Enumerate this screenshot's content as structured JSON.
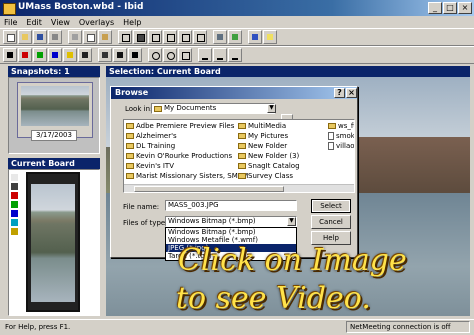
{
  "window": {
    "title": "UMass Boston.wbd - Ibid"
  },
  "menu": [
    "File",
    "Edit",
    "View",
    "Overlays",
    "Help"
  ],
  "snapshots": {
    "header": "Snapshots: 1",
    "date": "3/17/2003"
  },
  "current_board": {
    "header": "Current Board"
  },
  "selection": {
    "header": "Selection: Current Board"
  },
  "dialog": {
    "title": "Browse",
    "look_in_label": "Look in:",
    "look_in_value": "My Documents",
    "col1": [
      "Adbe Premiere Preview Files",
      "Alzheimer's",
      "DL Training",
      "Kevin O'Rourke Productions",
      "Kevin's ITV",
      "Marist Missionary Sisters, SMSM"
    ],
    "col2": [
      "MultiMedia",
      "My Pictures",
      "New Folder",
      "New Folder (3)",
      "SnagIt Catalog",
      "Survey Class"
    ],
    "col3": [
      "ws_ft",
      "smoke",
      "villao"
    ],
    "file_name_label": "File name:",
    "file_name_value": "MASS_003.JPG",
    "files_of_type_label": "Files of type:",
    "files_of_type_value": "Windows Bitmap (*.bmp)",
    "type_options": [
      "Windows Bitmap (*.bmp)",
      "Windows Metafile (*.wmf)",
      "JPEG (*.jpg)",
      "Targa (*.tga)"
    ],
    "select_label": "Select",
    "cancel_label": "Cancel",
    "help_label": "Help"
  },
  "overlay": {
    "line1": "Click on Image",
    "line2": "to see Video."
  },
  "status": {
    "left": "For Help, press F1.",
    "right": "NetMeeting connection is off"
  },
  "colors": {
    "title_bar": "#0a246a",
    "overlay_text": "#ffe24a",
    "swatches": [
      "#e8e8e8",
      "#404040",
      "#cc0000",
      "#00a000",
      "#0000cc",
      "#00a0c0",
      "#c0a000",
      "#ffffff"
    ]
  }
}
